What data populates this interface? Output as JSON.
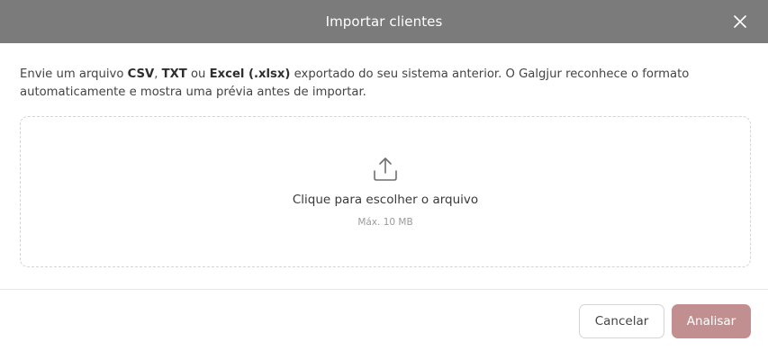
{
  "dialog": {
    "title": "Importar clientes",
    "close_icon": "close-icon"
  },
  "intro": {
    "prefix": "Envie um arquivo ",
    "fmt_csv": "CSV",
    "sep1": ", ",
    "fmt_txt": "TXT",
    "sep2": " ou ",
    "fmt_excel": "Excel (.xlsx)",
    "suffix": " exportado do seu sistema anterior. O Galgjur reconhece o formato automaticamente e mostra uma prévia antes de importar."
  },
  "dropzone": {
    "icon": "upload-icon",
    "label": "Clique para escolher o arquivo",
    "hint": "Máx. 10 MB"
  },
  "footer": {
    "cancel_label": "Cancelar",
    "submit_label": "Analisar"
  },
  "colors": {
    "header_bg": "#7b7b7b",
    "accent": "#c28f91"
  }
}
